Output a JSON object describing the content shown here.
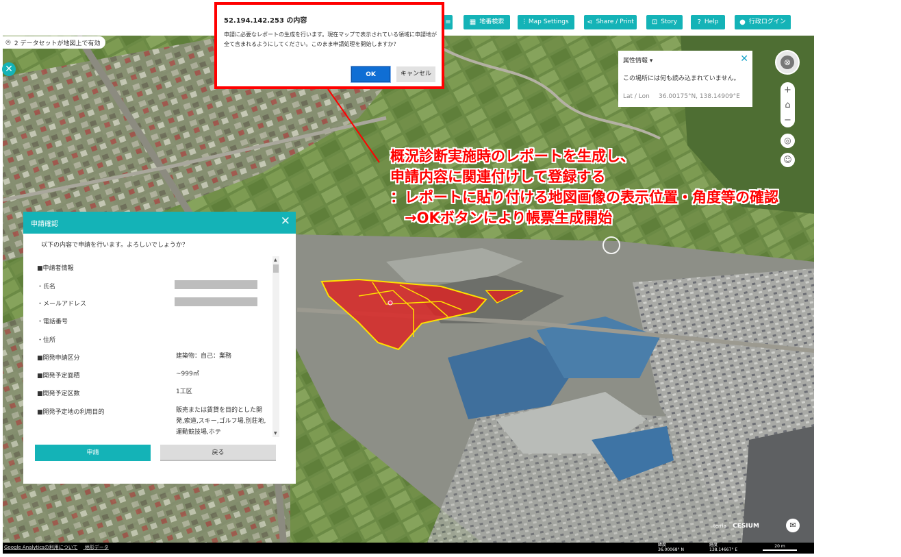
{
  "toolbar": {
    "buttons": [
      {
        "label": "",
        "icon": "layers-icon"
      },
      {
        "label": "地番検索",
        "icon": "building-icon"
      },
      {
        "label": "Map Settings",
        "icon": "sliders-icon"
      },
      {
        "label": "Share / Print",
        "icon": "share-icon"
      },
      {
        "label": "Story",
        "icon": "story-icon"
      },
      {
        "label": "Help",
        "icon": "help-icon"
      },
      {
        "label": "行政ログイン",
        "icon": "user-icon"
      }
    ]
  },
  "datasets_badge": "2 データセットが地図上で有効",
  "dialog": {
    "title": "52.194.142.253 の内容",
    "message": "申請に必要なレポートの生成を行います。現在マップで表示されている領域に申請地が全て含まれるようにしてください。このまま申請処理を開始しますか？",
    "ok": "OK",
    "cancel": "キャンセル"
  },
  "property_panel": {
    "title": "属性情報",
    "message": "この場所には何も読み込まれていません。",
    "latlon_label": "Lat / Lon",
    "latlon_value": "36.00175°N, 138.14909°E"
  },
  "annotation": {
    "lines": [
      "概況診断実施時のレポートを生成し、",
      "申請内容に関連付けして登録する",
      "：レポートに貼り付ける地図画像の表示位置・角度等の確認",
      "　→OKボタンにより帳票生成開始"
    ],
    "color": "#ff0000"
  },
  "apply_panel": {
    "title": "申請確認",
    "intro": "以下の内容で申請を行います。よろしいでしょうか？",
    "rows": [
      {
        "key": "■申請者情報",
        "value": ""
      },
      {
        "key": "・氏名",
        "value": ""
      },
      {
        "key": "・メールアドレス",
        "value": ""
      },
      {
        "key": "・電話番号",
        "value": ""
      },
      {
        "key": "・住所",
        "value": ""
      },
      {
        "key": "■開発申請区分",
        "value": "建築物：自己：業務"
      },
      {
        "key": "■開発予定面積",
        "value": "~999㎡"
      },
      {
        "key": "■開発予定区数",
        "value": "1工区"
      },
      {
        "key": "■開発予定地の利用目的",
        "value": "販売または賃貸を目的とした開発,索道,スキー,ゴルフ場,別荘地,運動競技場,ホテ"
      }
    ],
    "apply_label": "申請",
    "back_label": "戻る"
  },
  "bottom_bar": {
    "links": [
      "Google Analyticsの利用について",
      "地形データ"
    ],
    "lat_label": "緯度",
    "lat_value": "36.00068° N",
    "lon_label": "経度",
    "lon_value": "138.14667° E",
    "scale": "20 m"
  },
  "credits": {
    "terria": "terria",
    "cesium": "CESIUM"
  },
  "colors": {
    "accent": "#14b3b7",
    "alert_border": "#ff0000",
    "parcel": "#e02020"
  }
}
